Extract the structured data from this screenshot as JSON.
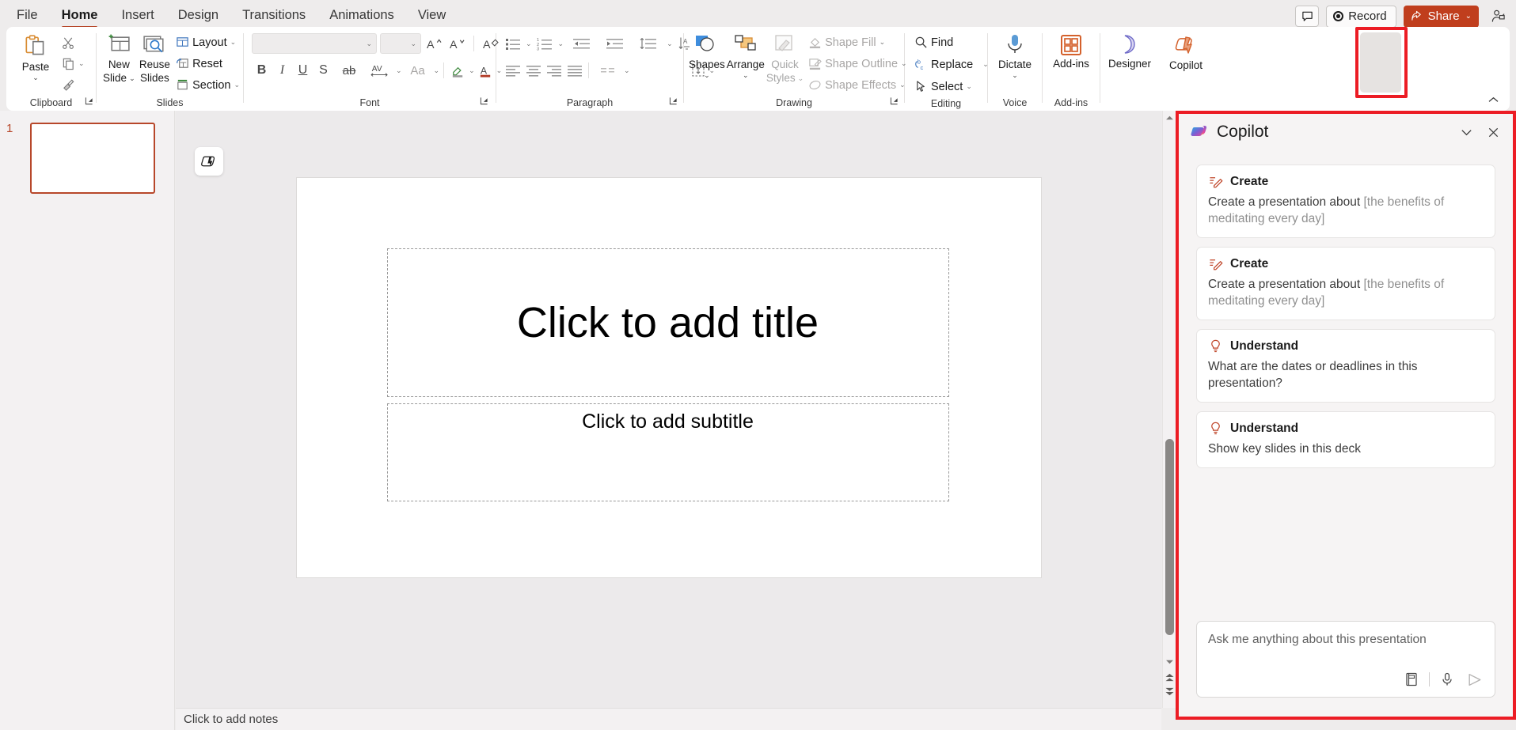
{
  "app": {
    "name": "PowerPoint"
  },
  "tabs": [
    {
      "label": "File",
      "active": false
    },
    {
      "label": "Home",
      "active": true
    },
    {
      "label": "Insert",
      "active": false
    },
    {
      "label": "Design",
      "active": false
    },
    {
      "label": "Transitions",
      "active": false
    },
    {
      "label": "Animations",
      "active": false
    },
    {
      "label": "View",
      "active": false
    }
  ],
  "title_right": {
    "comments_icon": "comment-icon",
    "record_label": "Record",
    "share_label": "Share",
    "share_chevron": "⌄",
    "person_icon": "share-person-icon"
  },
  "ribbon": {
    "groups": [
      {
        "label": "Clipboard",
        "has_dialog_launcher": true
      },
      {
        "label": "Slides",
        "has_dialog_launcher": false
      },
      {
        "label": "Font",
        "has_dialog_launcher": true
      },
      {
        "label": "Paragraph",
        "has_dialog_launcher": true
      },
      {
        "label": "Drawing",
        "has_dialog_launcher": true
      },
      {
        "label": "Editing",
        "has_dialog_launcher": false
      },
      {
        "label": "Voice",
        "has_dialog_launcher": false
      },
      {
        "label": "Add-ins",
        "has_dialog_launcher": false
      }
    ],
    "clipboard": {
      "paste_label": "Paste",
      "cut_icon": "scissors-icon",
      "copy_icon": "copy-icon",
      "format_painter_icon": "format-painter-icon"
    },
    "slides": {
      "new_slide_line1": "New",
      "new_slide_line2": "Slide",
      "reuse_line1": "Reuse",
      "reuse_line2": "Slides",
      "layout_label": "Layout",
      "reset_label": "Reset",
      "section_label": "Section"
    },
    "font": {
      "font_name_value": "",
      "font_size_value": "",
      "increase_font_icon": "increase-font-size-icon",
      "decrease_font_icon": "decrease-font-size-icon",
      "clear_formatting_icon": "clear-formatting-icon",
      "bold_label": "B",
      "italic_label": "I",
      "underline_label": "U",
      "shadow_label": "S",
      "strikethrough_label": "ab",
      "char_spacing_label": "AV",
      "change_case_label": "Aa",
      "highlight_icon": "text-highlight-icon",
      "font_color_icon": "font-color-icon"
    },
    "paragraph": {
      "bullets_icon": "bullets-icon",
      "numbering_icon": "numbering-icon",
      "decrease_indent_icon": "decrease-indent-icon",
      "increase_indent_icon": "increase-indent-icon",
      "line_spacing_icon": "line-spacing-icon",
      "text_direction_icon": "text-direction-icon",
      "align_text_icon": "align-text-icon",
      "smartart_icon": "convert-to-smartart-icon",
      "align_left_icon": "align-left-icon",
      "align_center_icon": "align-center-icon",
      "align_right_icon": "align-right-icon",
      "justify_icon": "justify-icon",
      "columns_icon": "columns-icon"
    },
    "drawing": {
      "shapes_label": "Shapes",
      "arrange_label": "Arrange",
      "quick_styles_line1": "Quick",
      "quick_styles_line2": "Styles",
      "shape_fill_label": "Shape Fill",
      "shape_outline_label": "Shape Outline",
      "shape_effects_label": "Shape Effects"
    },
    "editing": {
      "find_label": "Find",
      "replace_label": "Replace",
      "select_label": "Select"
    },
    "voice": {
      "dictate_label": "Dictate"
    },
    "addins": {
      "addins_label": "Add-ins"
    },
    "designer": {
      "designer_label": "Designer"
    },
    "copilot": {
      "copilot_label": "Copilot",
      "highlighted": true
    },
    "collapse_icon": "collapse-ribbon-chevron-icon"
  },
  "thumbnails": {
    "slides": [
      {
        "number": "1",
        "selected": true
      }
    ]
  },
  "canvas": {
    "copilot_float_icon": "copilot-float-icon",
    "title_placeholder": "Click to add title",
    "subtitle_placeholder": "Click to add subtitle"
  },
  "notes": {
    "placeholder": "Click to add notes"
  },
  "scrollbar": {
    "up_icon": "scroll-up-arrow-icon",
    "down_icon": "scroll-down-arrow-icon",
    "prev_slide_icon": "previous-slide-icon",
    "next_slide_icon": "next-slide-icon"
  },
  "copilot_pane": {
    "title": "Copilot",
    "logo_icon": "copilot-logo-icon",
    "minimize_icon": "chevron-down-icon",
    "close_icon": "close-icon",
    "cards": [
      {
        "kind": "Create",
        "icon": "create-pencil-icon",
        "text_main": "Create a presentation about ",
        "text_faded": "[the benefits of meditating every day]"
      },
      {
        "kind": "Create",
        "icon": "create-pencil-icon",
        "text_main": "Create a presentation about ",
        "text_faded": "[the benefits of meditating every day]"
      },
      {
        "kind": "Understand",
        "icon": "lightbulb-icon",
        "text_main": "What are the dates or deadlines in this presentation?",
        "text_faded": ""
      },
      {
        "kind": "Understand",
        "icon": "lightbulb-icon",
        "text_main": "Show key slides in this deck",
        "text_faded": ""
      }
    ],
    "input": {
      "placeholder": "Ask me anything about this presentation",
      "prompt_guide_icon": "prompt-guide-icon",
      "mic_icon": "microphone-icon",
      "send_icon": "send-icon"
    }
  },
  "colors": {
    "accent": "#b7472a",
    "share": "#c03e1d",
    "highlight": "#ec1c24",
    "ribbon_bg": "#ffffff",
    "app_bg": "#eeecec"
  }
}
